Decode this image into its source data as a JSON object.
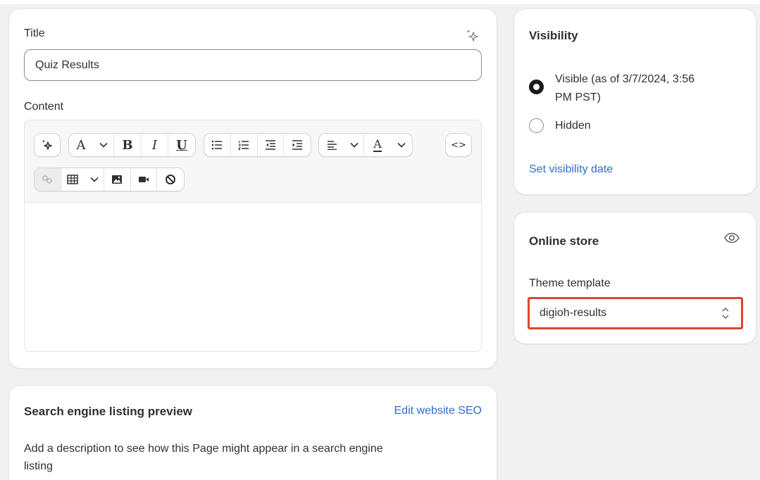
{
  "page_form": {
    "title_label": "Title",
    "title_value": "Quiz Results",
    "content_label": "Content",
    "toolbar_icons": [
      "ai-sparkle-icon",
      "text-format-icon",
      "bold-icon",
      "italic-icon",
      "underline-icon",
      "bullet-list-icon",
      "numbered-list-icon",
      "outdent-icon",
      "indent-icon",
      "align-icon",
      "text-color-icon",
      "code-view-icon",
      "link-icon",
      "table-icon",
      "image-icon",
      "video-icon",
      "clear-format-icon"
    ],
    "toolbar_glyphs": {
      "font": "A",
      "bold": "B",
      "italic": "I",
      "underline": "U",
      "text_color": "A",
      "code": "<>"
    }
  },
  "seo": {
    "heading": "Search engine listing preview",
    "edit_link": "Edit website SEO",
    "description_line1": "Add a description to see how this Page might appear in a search engine",
    "description_line2": "listing"
  },
  "visibility": {
    "heading": "Visibility",
    "option_visible_line1": "Visible (as of 3/7/2024, 3:56",
    "option_visible_line2": "PM PST)",
    "option_hidden": "Hidden",
    "selected": "visible",
    "set_date_link": "Set visibility date"
  },
  "online_store": {
    "heading": "Online store",
    "template_label": "Theme template",
    "template_value": "digioh-results",
    "highlight_color": "#e0452e"
  },
  "colors": {
    "background": "#f1f1f1",
    "card": "#ffffff",
    "link": "#2c6ecb",
    "text": "#303030"
  }
}
